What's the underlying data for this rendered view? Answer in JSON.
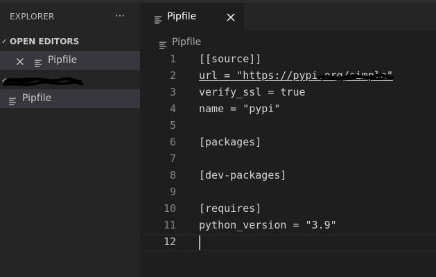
{
  "sidebar": {
    "title": "EXPLORER",
    "more_glyph": "···",
    "open_editors": {
      "label": "OPEN EDITORS",
      "chevron": "✓",
      "items": [
        {
          "label": "Pipfile",
          "icon": "lines-icon",
          "close_icon": "close-icon"
        }
      ]
    },
    "folder": {
      "chevron": "✓",
      "label": "",
      "items": [
        {
          "label": "Pipfile",
          "icon": "lines-icon"
        }
      ]
    }
  },
  "editor": {
    "tab": {
      "label": "Pipfile",
      "icon": "lines-icon",
      "close_icon": "close-icon"
    },
    "breadcrumb": {
      "label": "Pipfile",
      "icon": "lines-icon"
    },
    "lines": [
      {
        "number": "1",
        "text": "[[source]]"
      },
      {
        "number": "2",
        "text": "url = \"https://pypi.org/simple\""
      },
      {
        "number": "3",
        "text": "verify_ssl = true"
      },
      {
        "number": "4",
        "text": "name = \"pypi\""
      },
      {
        "number": "5",
        "text": ""
      },
      {
        "number": "6",
        "text": "[packages]"
      },
      {
        "number": "7",
        "text": ""
      },
      {
        "number": "8",
        "text": "[dev-packages]"
      },
      {
        "number": "9",
        "text": ""
      },
      {
        "number": "10",
        "text": "[requires]"
      },
      {
        "number": "11",
        "text": "python_version = \"3.9\""
      },
      {
        "number": "12",
        "text": ""
      }
    ],
    "cursor_line": "12"
  },
  "colors": {
    "sidebar_bg": "#252526",
    "editor_bg": "#1e1e1e",
    "selection_bg": "#37373d",
    "text": "#d4d4d4",
    "line_number": "#858585"
  }
}
